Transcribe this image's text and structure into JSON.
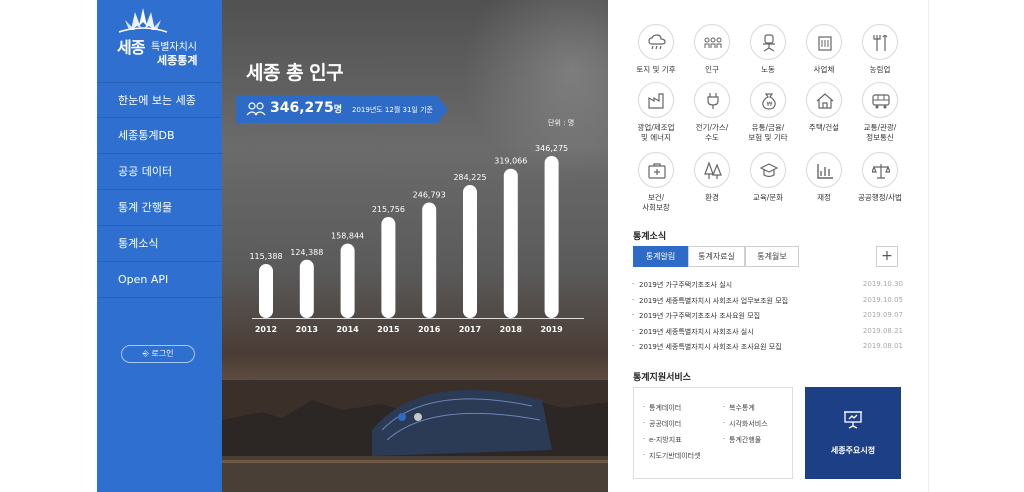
{
  "brand": {
    "city_short": "세종",
    "city_sub": "특별자치시",
    "service": "세종통계"
  },
  "sidebar": {
    "items": [
      {
        "label": "한눈에 보는 세종"
      },
      {
        "label": "세종통계DB"
      },
      {
        "label": "공공 데이터"
      },
      {
        "label": "통계 간행물"
      },
      {
        "label": "통계소식"
      },
      {
        "label": "Open API"
      }
    ],
    "login_label": "로그인"
  },
  "hero": {
    "title": "세종 총 인구",
    "total": "346,275",
    "total_unit": "명",
    "as_of": "2019년도 12월 31일 기준",
    "unit_label": "단위 : 명",
    "slides": [
      {
        "active": true
      },
      {
        "active": false
      }
    ]
  },
  "chart_data": {
    "type": "bar",
    "title": "세종 총 인구",
    "categories": [
      "2012",
      "2013",
      "2014",
      "2015",
      "2016",
      "2017",
      "2018",
      "2019"
    ],
    "values": [
      115388,
      124388,
      158844,
      215756,
      246793,
      284225,
      319066,
      346275
    ],
    "labels": [
      "115,388",
      "124,388",
      "158,844",
      "215,756",
      "246,793",
      "284,225",
      "319,066",
      "346,275"
    ],
    "ylabel": "단위 : 명",
    "ylim": [
      0,
      346275
    ],
    "grid": false,
    "bar_color": "#ffffff"
  },
  "categories": [
    {
      "label": "토지 및 기후",
      "icon": "cloud-rain-icon"
    },
    {
      "label": "인구",
      "icon": "people-icon"
    },
    {
      "label": "노동",
      "icon": "office-chair-icon"
    },
    {
      "label": "사업체",
      "icon": "office-building-icon"
    },
    {
      "label": "농림업",
      "icon": "farm-tools-icon"
    },
    {
      "label": "광업/제조업\n및 에너지",
      "icon": "factory-icon"
    },
    {
      "label": "전기/가스/\n수도",
      "icon": "plug-icon"
    },
    {
      "label": "유통/금융/\n보험 및 기타",
      "icon": "money-bag-icon"
    },
    {
      "label": "주택/건설",
      "icon": "house-icon"
    },
    {
      "label": "교통/관광/\n정보통신",
      "icon": "bus-icon"
    },
    {
      "label": "보건/\n사회보장",
      "icon": "first-aid-icon"
    },
    {
      "label": "환경",
      "icon": "trees-icon"
    },
    {
      "label": "교육/문화",
      "icon": "graduation-cap-icon"
    },
    {
      "label": "재정",
      "icon": "bar-chart-icon"
    },
    {
      "label": "공공행정/사법",
      "icon": "scales-icon"
    }
  ],
  "news": {
    "title": "통계소식",
    "tabs": [
      {
        "label": "통계알림",
        "active": true
      },
      {
        "label": "통계자료실",
        "active": false
      },
      {
        "label": "통계월보",
        "active": false
      }
    ],
    "more_label": "+",
    "items": [
      {
        "title": "2019년 가구주택기초조사 실시",
        "date": "2019.10.30"
      },
      {
        "title": "2019년 세종특별자치시 사회조사 업무보조원 모집",
        "date": "2019.10.05"
      },
      {
        "title": "2019년 가구주택기초조사 조사요원 모집",
        "date": "2019.09.07"
      },
      {
        "title": "2019년 세종특별자치시 사회조사 실시",
        "date": "2019.08.21"
      },
      {
        "title": "2019년 세종특별자치시 사회조사 조사요원 모집",
        "date": "2019.08.01"
      }
    ]
  },
  "services": {
    "title": "통계지원서비스",
    "left": [
      "통계데이터",
      "공공데이터",
      "e-지방지표",
      "지도기반데이터셋"
    ],
    "right": [
      "복수통계",
      "시각화서비스",
      "통계간행물"
    ],
    "market_label": "세종주요시정"
  },
  "colors": {
    "sidebar": "#2f6fd0",
    "accent": "#2d6bc7",
    "navy": "#1d3f86"
  }
}
